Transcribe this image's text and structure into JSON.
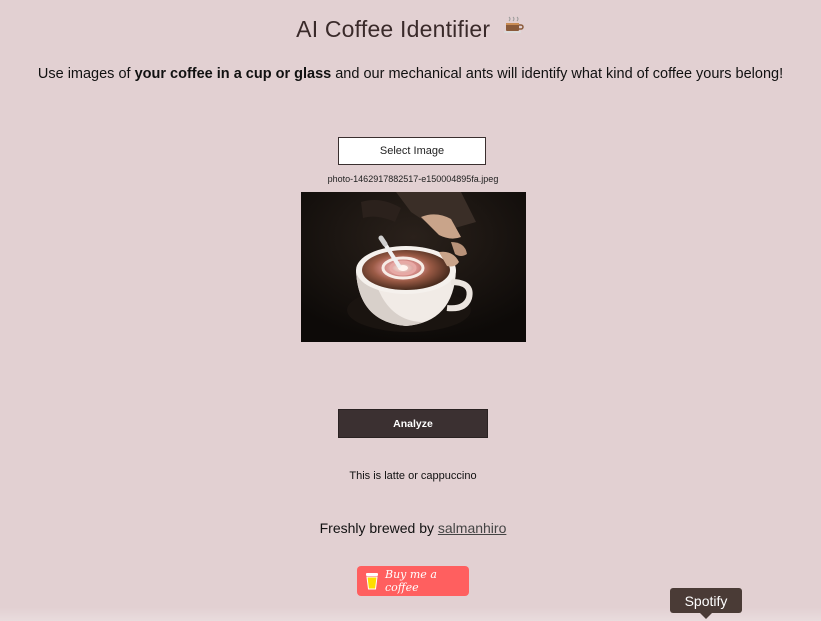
{
  "header": {
    "title": "AI Coffee Identifier",
    "title_icon": "coffee-cup-icon"
  },
  "intro": {
    "prefix": "Use images of ",
    "bold": "your coffee in a cup or glass",
    "suffix": " and our mechanical ants will identify what kind of coffee yours belong!"
  },
  "upload": {
    "select_label": "Select Image",
    "filename": "photo-1462917882517-e150004895fa.jpeg",
    "preview_icon": "latte-art-photo"
  },
  "analyze": {
    "button_label": "Analyze",
    "result_text": "This is latte or cappuccino"
  },
  "footer": {
    "credit_prefix": "Freshly brewed by ",
    "credit_link": "salmanhiro",
    "bmc_label": "Buy me a coffee",
    "bmc_icon": "coffee-cup-icon",
    "bmc_color": "#ff5f5f"
  },
  "tooltip": {
    "text": "Spotify"
  },
  "colors": {
    "background": "#e2d0d2",
    "analyze_button": "#3b3031",
    "tooltip": "#4a3b36"
  }
}
